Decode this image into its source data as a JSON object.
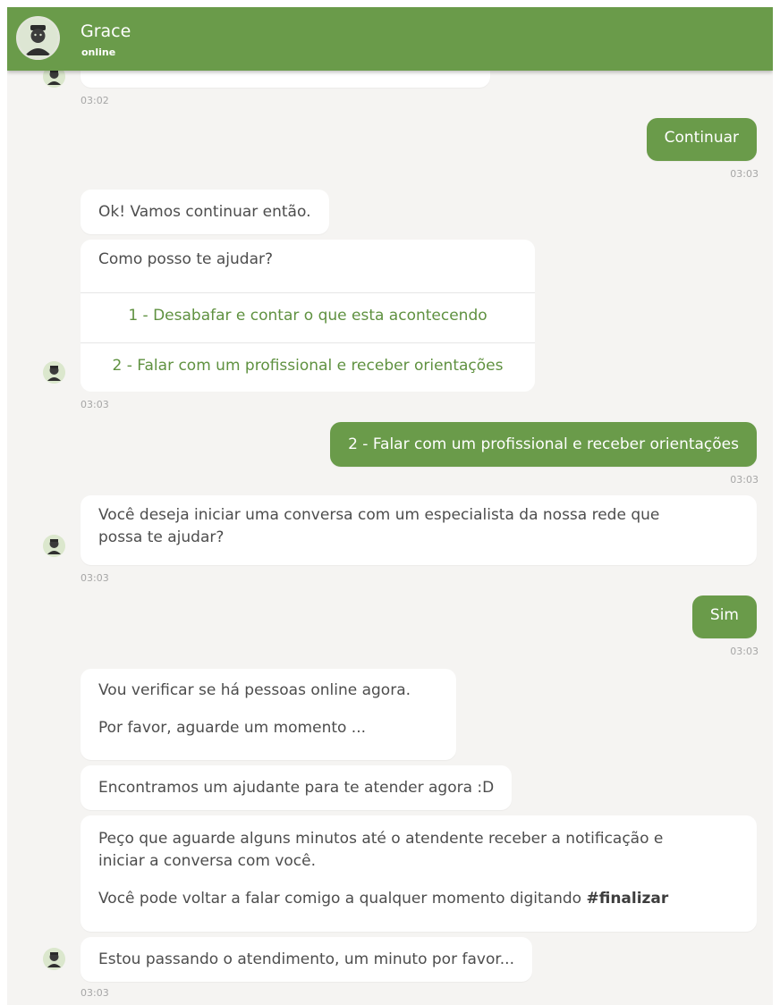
{
  "header": {
    "name": "Grace",
    "status": "online"
  },
  "colors": {
    "brand_green": "#6a9b4a",
    "background": "#f5f4f2",
    "bubble_white": "#ffffff"
  },
  "messages": {
    "m0_time": "03:02",
    "m1": {
      "text": "Continuar",
      "time": "03:03"
    },
    "m2": {
      "text": "Ok! Vamos continuar então."
    },
    "m3": {
      "question": "Como posso te ajudar?",
      "option_1": "1 - Desabafar e contar o que esta acontecendo",
      "option_2": "2 - Falar com um profissional e receber orientações",
      "time": "03:03"
    },
    "m4": {
      "text": "2 - Falar com um profissional e receber orientações",
      "time": "03:03"
    },
    "m5": {
      "line1": "Você deseja iniciar uma conversa com um especialista da nossa rede que",
      "line2": "possa te ajudar?",
      "time": "03:03"
    },
    "m6": {
      "text": "Sim",
      "time": "03:03"
    },
    "m7": {
      "line1": "Vou verificar se há pessoas online agora.",
      "line2": "Por favor, aguarde um momento ..."
    },
    "m8": {
      "text": "Encontramos um ajudante para te atender agora :D"
    },
    "m9": {
      "line1": "Peço que aguarde alguns minutos até o atendente receber a notificação e",
      "line2": "iniciar a conversa com você.",
      "line3_prefix": "Você pode voltar a falar comigo a qualquer momento digitando ",
      "line3_hashtag": "#finalizar"
    },
    "m10": {
      "text": "Estou passando o atendimento, um minuto por favor...",
      "time": "03:03"
    }
  }
}
